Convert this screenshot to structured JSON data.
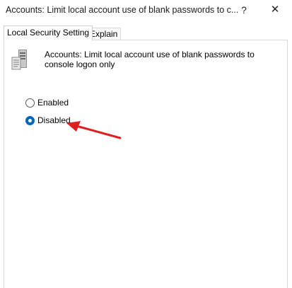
{
  "window": {
    "title": "Accounts: Limit local account use of blank passwords to c...",
    "help_glyph": "?",
    "close_glyph": "✕"
  },
  "tabs": [
    {
      "label": "Local Security Setting",
      "active": true
    },
    {
      "label": "Explain",
      "active": false
    }
  ],
  "policy": {
    "icon": "server-policy-icon",
    "description": "Accounts: Limit local account use of blank passwords to console logon only"
  },
  "options": [
    {
      "label": "Enabled",
      "selected": false
    },
    {
      "label": "Disabled",
      "selected": true
    }
  ],
  "annotation": {
    "icon": "red-arrow-icon",
    "color": "#e02020"
  },
  "colors": {
    "accent": "#0067c0"
  }
}
